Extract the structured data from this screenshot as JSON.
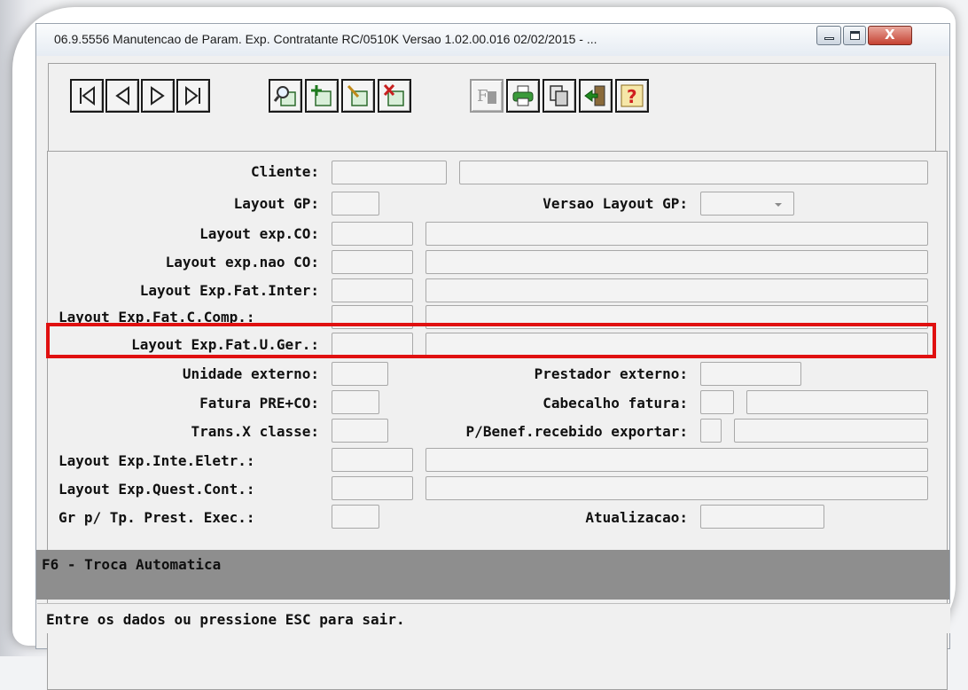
{
  "window": {
    "title": "06.9.5556 Manutencao  de Param. Exp. Contratante RC/0510K Versao 1.02.00.016 02/02/2015 - ...",
    "close_glyph": "X"
  },
  "toolbar": {
    "buttons": [
      {
        "name": "first-record-icon"
      },
      {
        "name": "previous-record-icon"
      },
      {
        "name": "next-record-icon"
      },
      {
        "name": "last-record-icon"
      },
      {
        "name": "search-icon"
      },
      {
        "name": "add-record-icon"
      },
      {
        "name": "edit-record-icon"
      },
      {
        "name": "delete-record-icon"
      },
      {
        "name": "filter-icon"
      },
      {
        "name": "print-icon"
      },
      {
        "name": "copy-icon"
      },
      {
        "name": "exit-icon"
      },
      {
        "name": "help-icon"
      }
    ],
    "help_glyph": "?",
    "filter_glyph": "F"
  },
  "form": {
    "cliente": "Cliente:",
    "layout_gp": "Layout GP:",
    "versao_layout_gp": "Versao Layout GP:",
    "layout_exp_co": "Layout exp.CO:",
    "layout_exp_nao_co": "Layout exp.nao CO:",
    "layout_exp_fat_inter": "Layout Exp.Fat.Inter:",
    "layout_exp_fat_c_comp": "Layout Exp.Fat.C.Comp.:",
    "layout_exp_fat_u_ger": "Layout Exp.Fat.U.Ger.:",
    "unidade_externo": "Unidade externo:",
    "prestador_externo": "Prestador externo:",
    "fatura_pre_co": "Fatura PRE+CO:",
    "cabecalho_fatura": "Cabecalho fatura:",
    "trans_x_classe": "Trans.X classe:",
    "p_benef_recebido_exportar": "P/Benef.recebido exportar:",
    "layout_exp_inte_eletr": "Layout Exp.Inte.Eletr.:",
    "layout_exp_quest_cont": "Layout Exp.Quest.Cont.:",
    "gr_tp_prest_exec": "Gr p/ Tp. Prest. Exec.:",
    "atualizacao": "Atualizacao:"
  },
  "messages": {
    "f6": "F6 - Troca Automatica",
    "status": "Entre os dados ou pressione ESC para sair."
  },
  "colors": {
    "highlight": "#e01010",
    "message_bar": "#8e8e8e"
  }
}
